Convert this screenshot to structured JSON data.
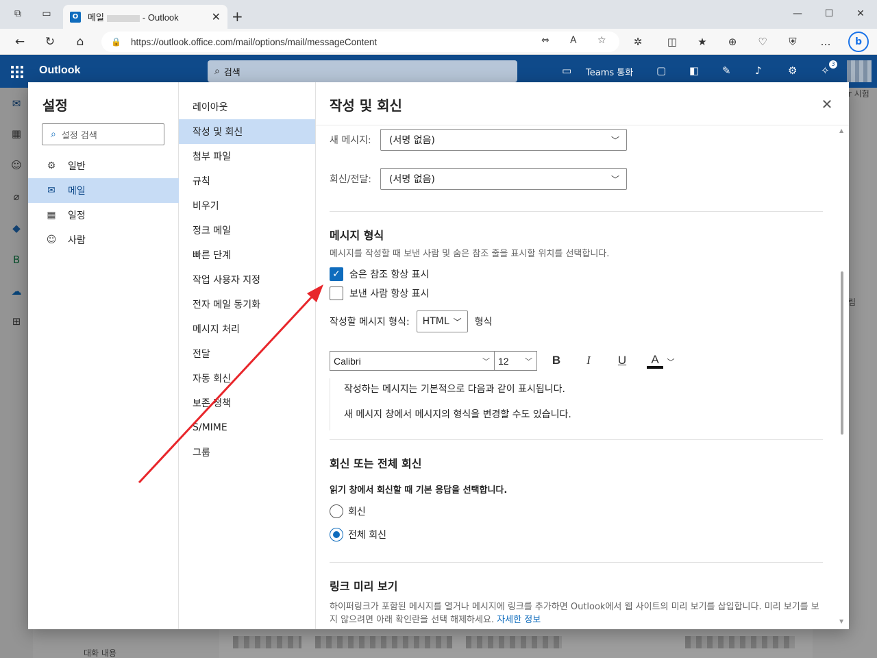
{
  "browser": {
    "tab_title_prefix": "메일",
    "tab_title_suffix": "- Outlook",
    "url": "https://outlook.office.com/mail/options/mail/messageContent"
  },
  "outlook": {
    "brand": "Outlook",
    "search_placeholder": "검색",
    "teams_label": "Teams 통화",
    "tips_badge": "3",
    "bg_partial_1": "r 시험",
    "bg_partial_2": "림",
    "bg_folder": "대화 내용"
  },
  "settings": {
    "title": "설정",
    "search_placeholder": "설정 검색",
    "categories": [
      {
        "label": "일반",
        "icon": "gear-icon"
      },
      {
        "label": "메일",
        "icon": "mail-icon"
      },
      {
        "label": "일정",
        "icon": "calendar-icon"
      },
      {
        "label": "사람",
        "icon": "people-icon"
      }
    ],
    "mail_sections": [
      "레이아웃",
      "작성 및 회신",
      "첨부 파일",
      "규칙",
      "비우기",
      "정크 메일",
      "빠른 단계",
      "작업 사용자 지정",
      "전자 메일 동기화",
      "메시지 처리",
      "전달",
      "자동 회신",
      "보존 정책",
      "S/MIME",
      "그룹"
    ]
  },
  "panel": {
    "title": "작성 및 회신",
    "signature": {
      "new_label": "새 메시지:",
      "new_value": "(서명 없음)",
      "reply_label": "회신/전달:",
      "reply_value": "(서명 없음)"
    },
    "message_format": {
      "heading": "메시지 형식",
      "description": "메시지를 작성할 때 보낸 사람 및 숨은 참조 줄을 표시할 위치를 선택합니다.",
      "always_show_bcc": "숨은 참조 항상 표시",
      "always_show_bcc_checked": true,
      "always_show_from": "보낸 사람 항상 표시",
      "always_show_from_checked": false,
      "compose_format_label": "작성할 메시지 형식:",
      "compose_format_value": "HTML",
      "compose_format_suffix": "형식",
      "font_name": "Calibri",
      "font_size": "12",
      "bold": "B",
      "italic": "I",
      "underline": "U",
      "preview_line1": "작성하는 메시지는 기본적으로 다음과 같이 표시됩니다.",
      "preview_line2": "새 메시지 창에서 메시지의 형식을 변경할 수도 있습니다."
    },
    "reply": {
      "heading": "회신 또는 전체 회신",
      "description": "읽기 창에서 회신할 때 기본 응답을 선택합니다.",
      "option_reply": "회신",
      "option_reply_all": "전체 회신",
      "selected": "전체 회신"
    },
    "link_preview": {
      "heading": "링크 미리 보기",
      "description": "하이퍼링크가 포함된 메시지를 열거나 메시지에 링크를 추가하면 Outlook에서 웹 사이트의 미리 보기를 삽입합니다. 미리 보기를 보지 않으려면 아래 확인란을 선택 해제하세요.",
      "learn_more": "자세한 정보"
    }
  },
  "colors": {
    "accent": "#0f6cbd",
    "header": "#0f4a8a",
    "selected_bg": "#c7dcf5",
    "annotation_arrow": "#e8262b"
  }
}
